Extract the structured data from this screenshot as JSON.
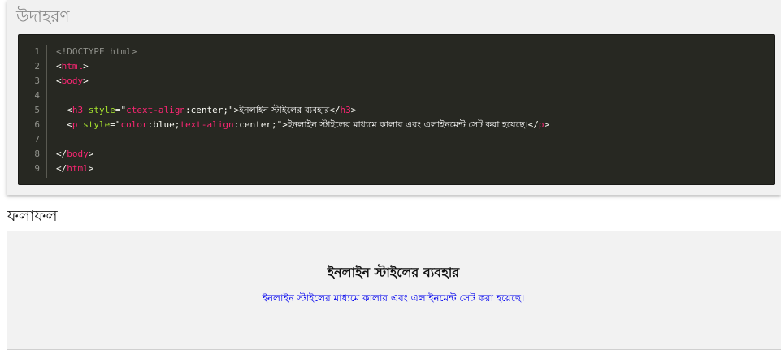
{
  "example": {
    "title": "উদাহরণ",
    "line_numbers": [
      "1",
      "2",
      "3",
      "4",
      "5",
      "6",
      "7",
      "8",
      "9"
    ],
    "code": {
      "l1": "<!DOCTYPE html>",
      "l2_open": "<",
      "l2_tag": "html",
      "l2_close": ">",
      "l3_open": "<",
      "l3_tag": "body",
      "l3_close": ">",
      "l5_indent": "  ",
      "l5_open": "<",
      "l5_tag": "h3",
      "l5_space": " ",
      "l5_attr": "style",
      "l5_eq": "=\"",
      "l5_prop": "ctext-align",
      "l5_colon": ":",
      "l5_val": "center",
      "l5_semi": ";\"",
      "l5_gt": ">",
      "l5_text": "ইনলাইন স্টাইলের ব্যবহার",
      "l5_endopen": "</",
      "l5_endtag": "h3",
      "l5_endclose": ">",
      "l6_indent": "  ",
      "l6_open": "<",
      "l6_tag": "p",
      "l6_space": " ",
      "l6_attr": "style",
      "l6_eq": "=\"",
      "l6_prop1": "color",
      "l6_colon1": ":",
      "l6_val1": "blue",
      "l6_semi1": ";",
      "l6_prop2": "text-align",
      "l6_colon2": ":",
      "l6_val2": "center",
      "l6_semi2": ";\"",
      "l6_gt": ">",
      "l6_text": "ইনলাইন স্টাইলের মাধ্যমে কালার এবং এলাইনমেন্ট সেট করা হয়েছে।",
      "l6_endopen": "</",
      "l6_endtag": "p",
      "l6_endclose": ">",
      "l8_open": "</",
      "l8_tag": "body",
      "l8_close": ">",
      "l9_open": "</",
      "l9_tag": "html",
      "l9_close": ">"
    }
  },
  "result": {
    "title": "ফলাফল",
    "heading": "ইনলাইন স্টাইলের ব্যবহার",
    "paragraph": "ইনলাইন স্টাইলের মাধ্যমে কালার এবং এলাইনমেন্ট সেট করা হয়েছে।",
    "paragraph_color": "#0000ee"
  },
  "colors": {
    "code_background": "#272822",
    "tag": "#f92672",
    "attribute": "#a6e22e",
    "comment": "#8f908a"
  }
}
